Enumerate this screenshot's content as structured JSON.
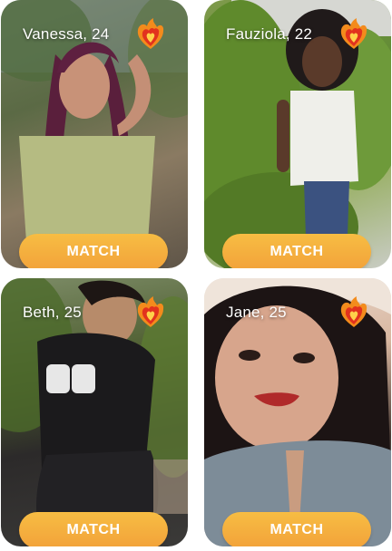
{
  "profiles": [
    {
      "name": "Vanessa, 24",
      "button": "MATCH"
    },
    {
      "name": "Fauziola, 22",
      "button": "MATCH"
    },
    {
      "name": "Beth, 25",
      "button": "MATCH"
    },
    {
      "name": "Jane, 25",
      "button": "MATCH"
    }
  ],
  "icons": {
    "badge": "fire-heart-icon"
  },
  "colors": {
    "match_button": "#f4ab3d",
    "name_text": "#ffffff"
  }
}
